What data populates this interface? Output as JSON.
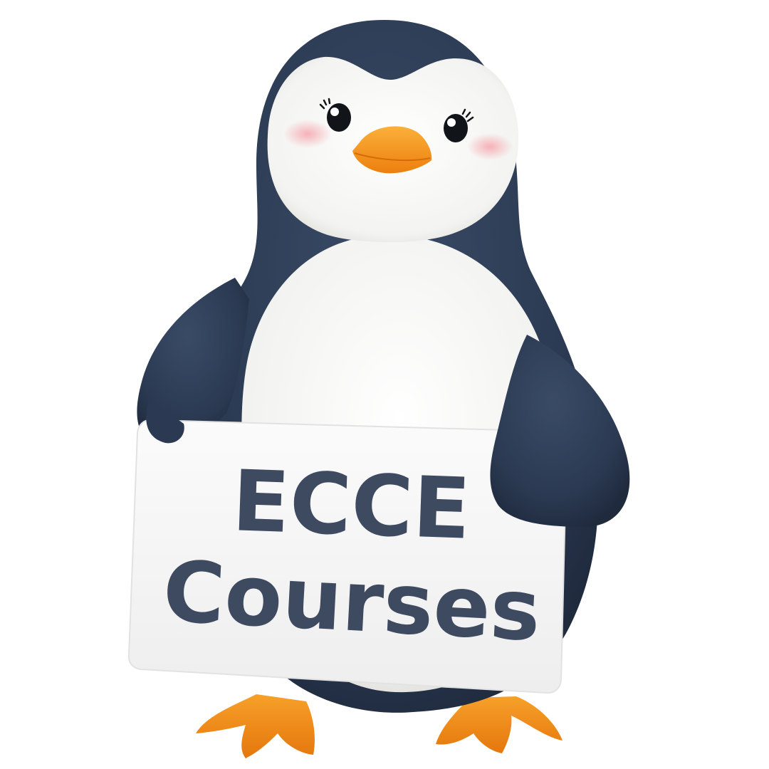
{
  "sign": {
    "line1": "ECCE",
    "line2": "Courses"
  },
  "colors": {
    "background": "#ffffff",
    "body_dark": "#2b3a52",
    "belly": "#f4f4f2",
    "beak": "#f59a1c",
    "feet": "#f08a12",
    "cheek": "#f6b3b8",
    "sign_board": "#f7f7f7",
    "sign_text": "#3e4a60"
  }
}
